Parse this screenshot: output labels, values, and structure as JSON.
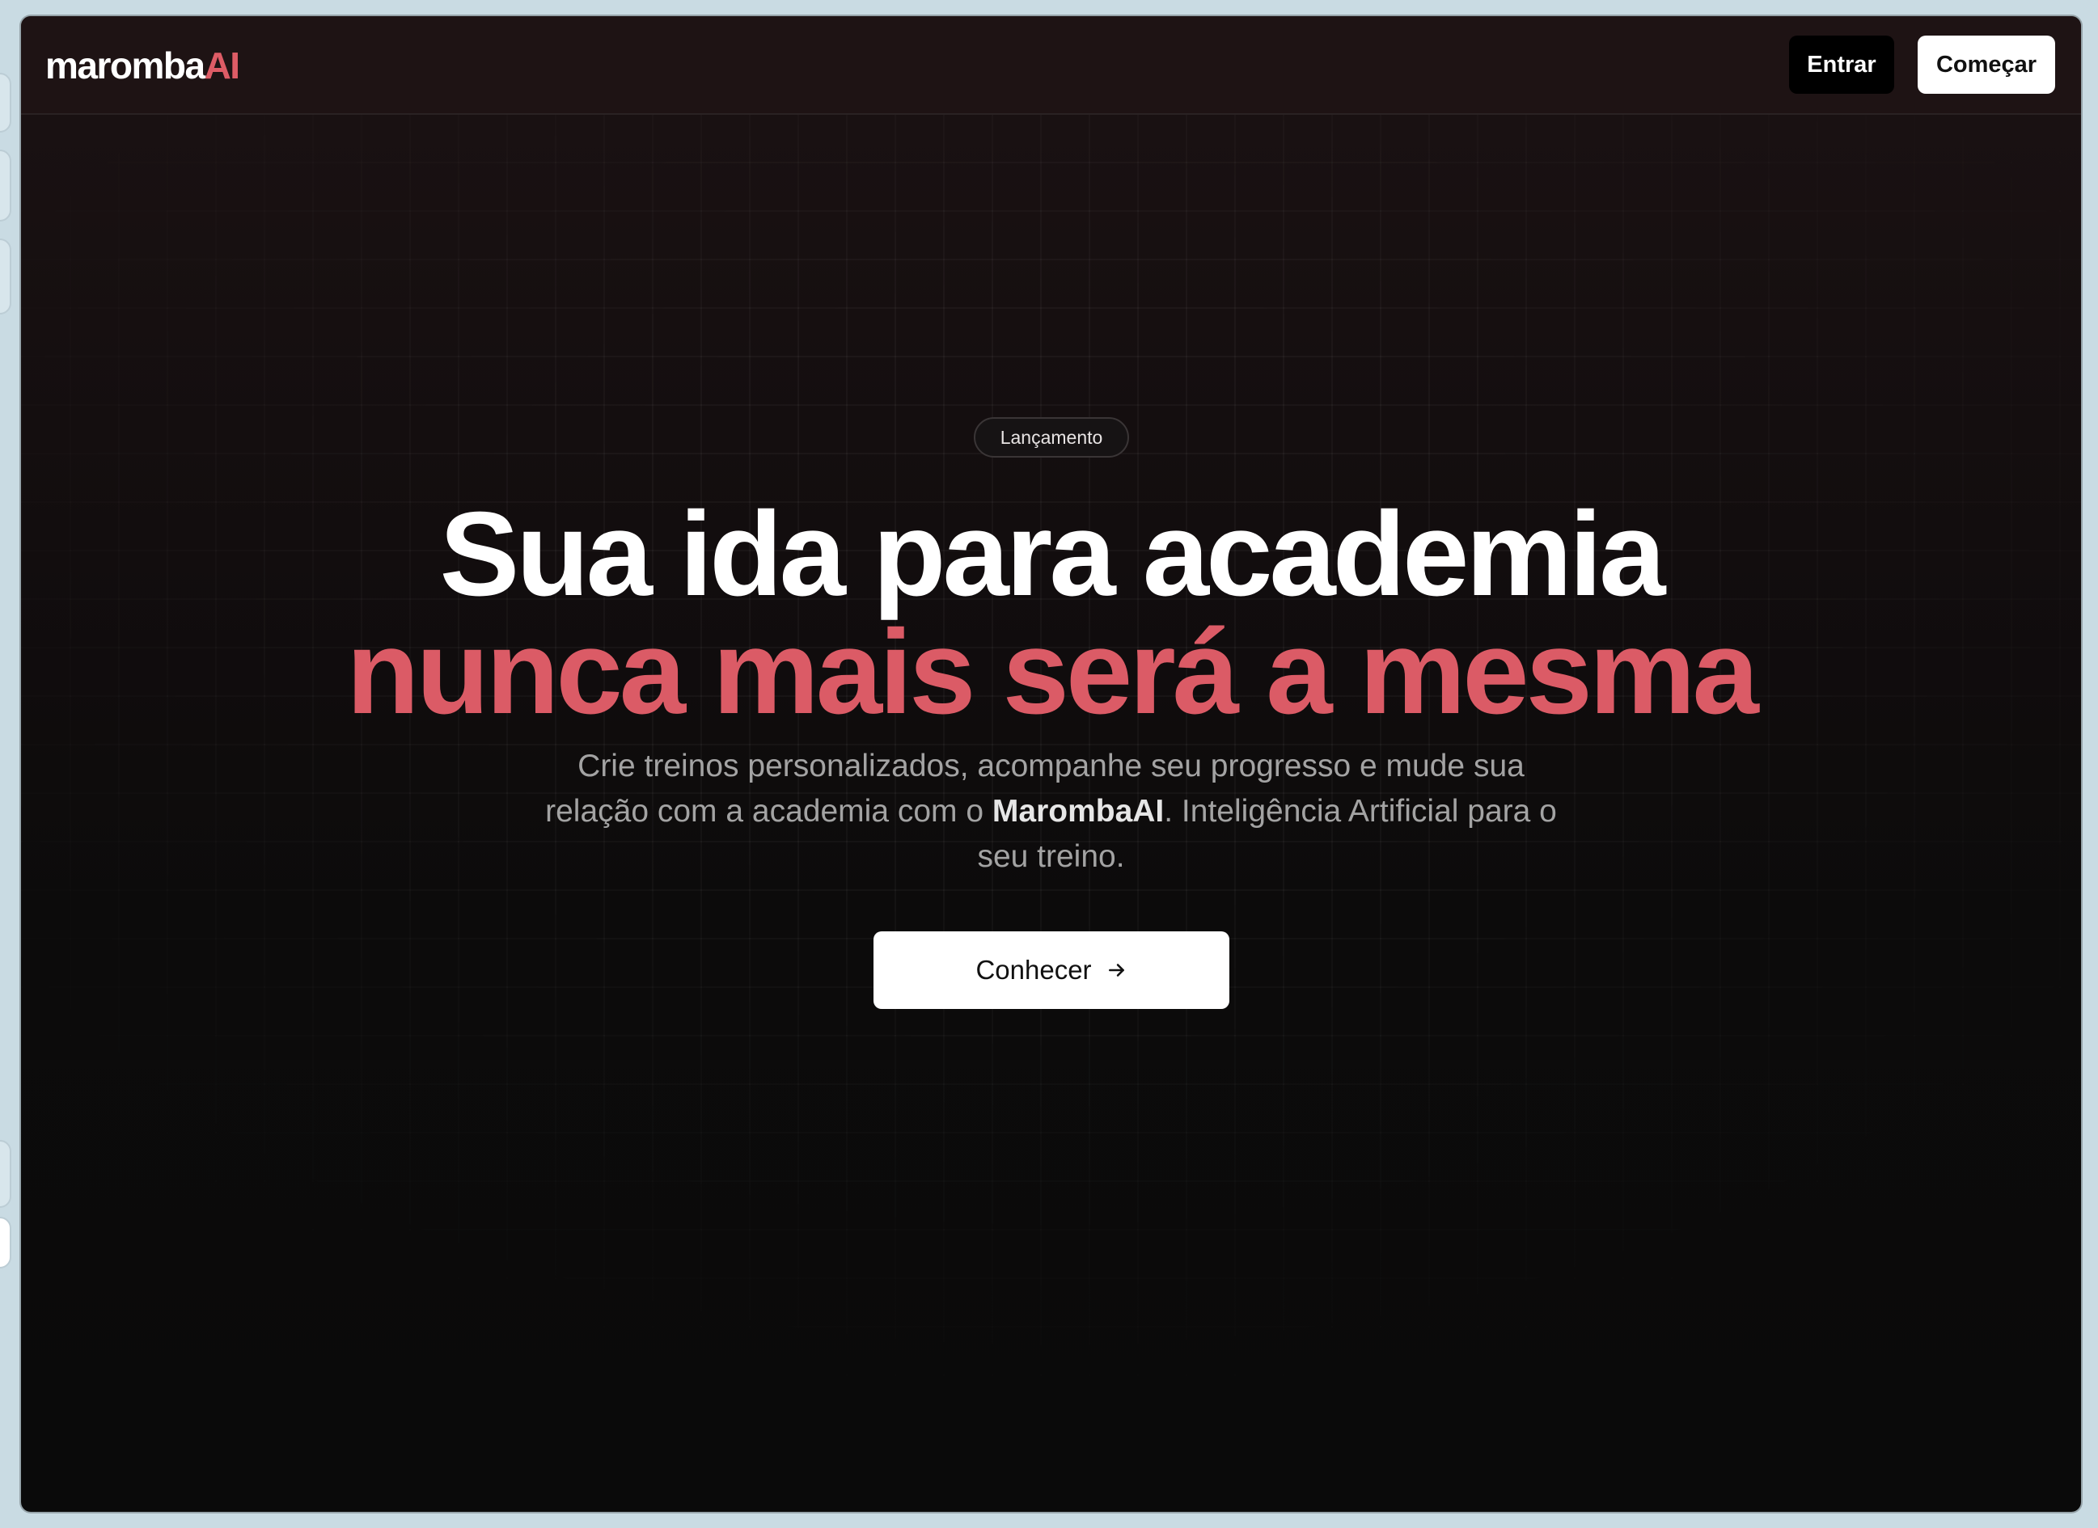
{
  "nav": {
    "logo_main": "maromba",
    "logo_accent": "AI",
    "login_label": "Entrar",
    "start_label": "Começar"
  },
  "hero": {
    "badge": "Lançamento",
    "headline_line1": "Sua ida para academia",
    "headline_line2": "nunca mais será a mesma",
    "subtitle_part1": "Crie treinos personalizados, acompanhe seu progresso e mude sua relação com a academia com o ",
    "subtitle_brand": "MarombaAI",
    "subtitle_part2": ". Inteligência Artificial para o seu treino.",
    "cta_label": "Conhecer",
    "cta_icon": "arrow-right-icon"
  },
  "colors": {
    "accent": "#db5b66",
    "background": "#0a0a0a",
    "text_primary": "#ffffff",
    "text_muted": "#a3a3a3"
  }
}
